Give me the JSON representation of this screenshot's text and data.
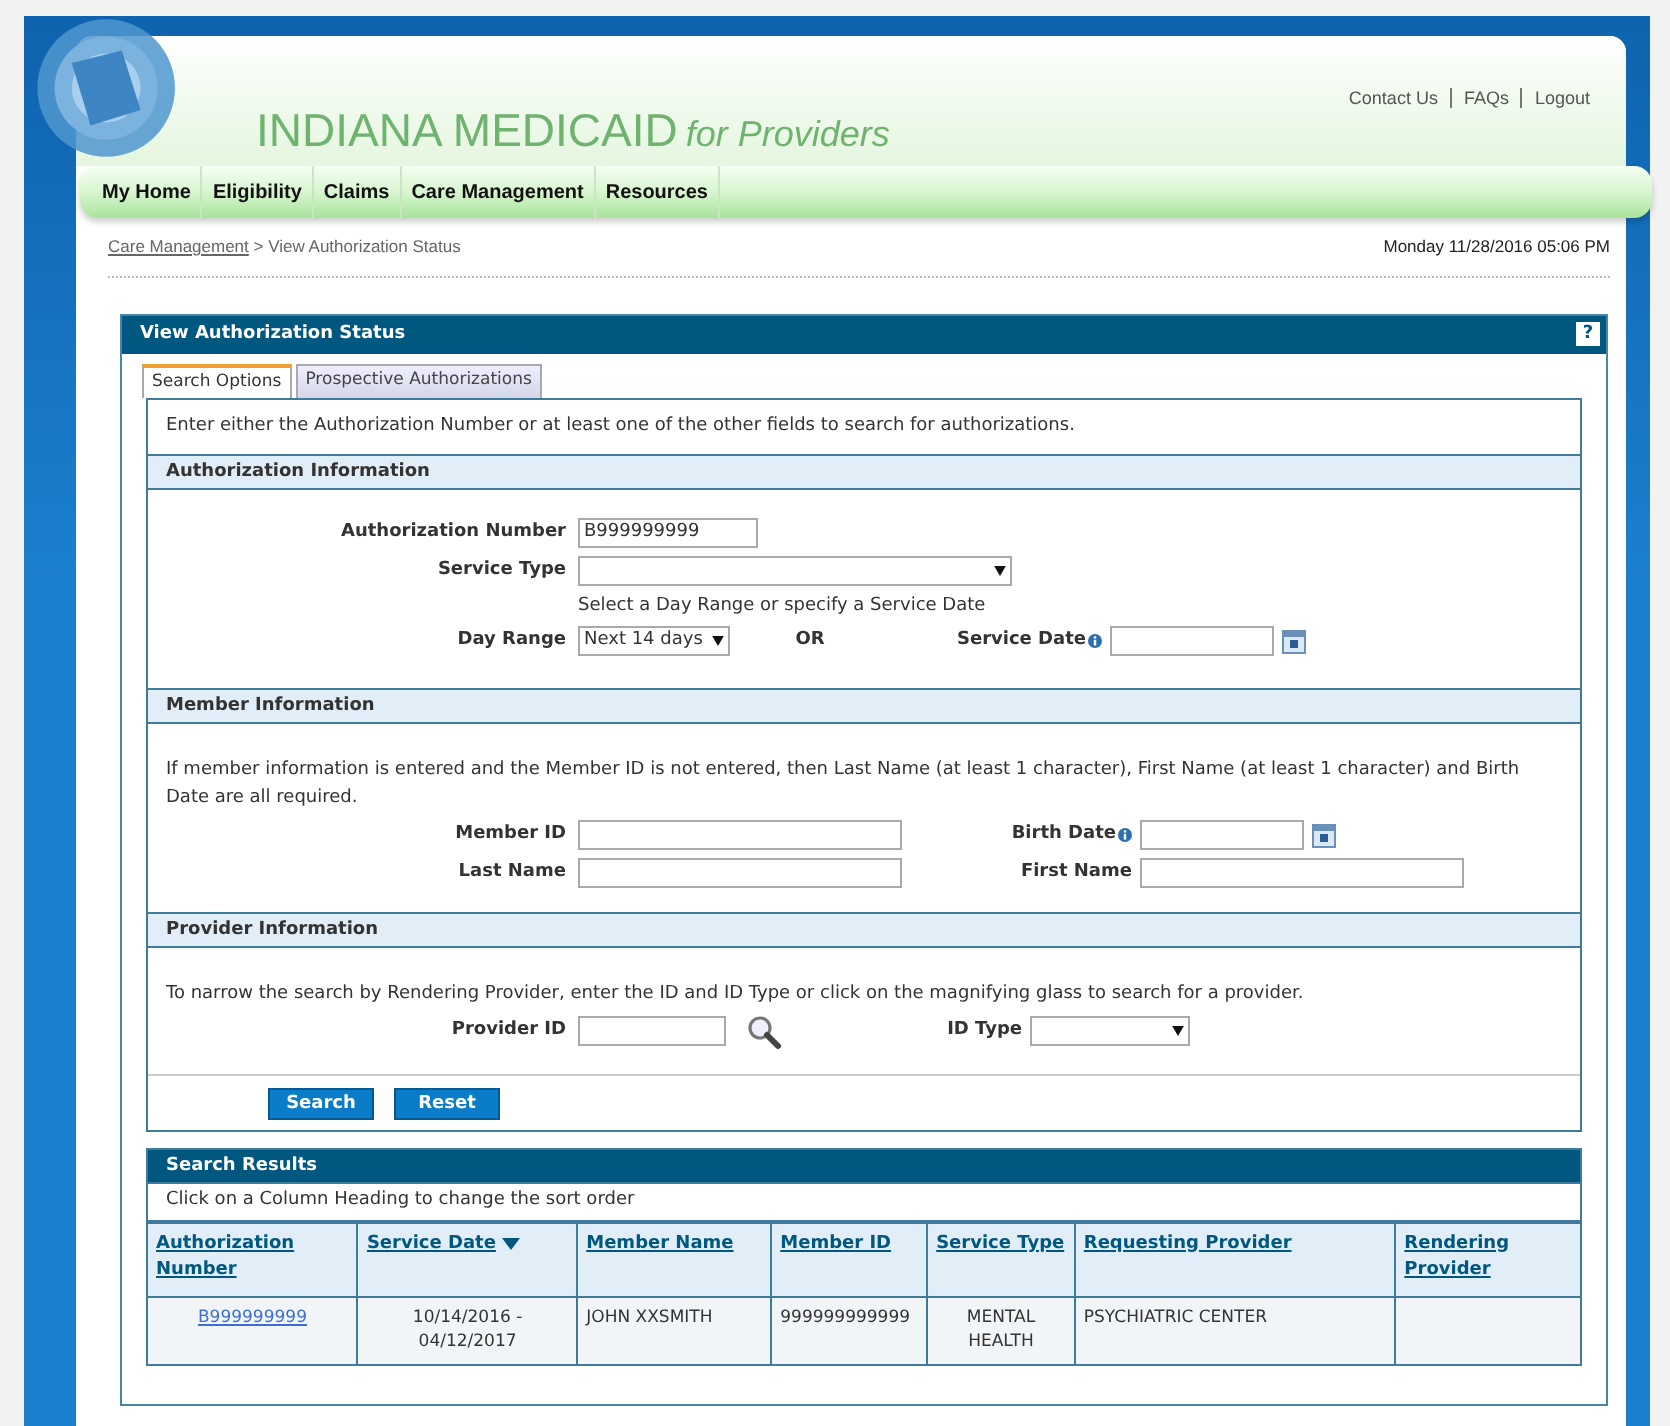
{
  "header": {
    "title": "INDIANA MEDICAID",
    "subtitle": "for Providers",
    "links": [
      {
        "label": "Contact Us"
      },
      {
        "label": "FAQs"
      },
      {
        "label": "Logout"
      }
    ]
  },
  "nav": [
    {
      "label": "My Home"
    },
    {
      "label": "Eligibility"
    },
    {
      "label": "Claims"
    },
    {
      "label": "Care Management"
    },
    {
      "label": "Resources"
    }
  ],
  "breadcrumb": {
    "link": "Care Management",
    "current": "> View Authorization Status",
    "datetime": "Monday 11/28/2016 05:06 PM"
  },
  "panel": {
    "title": "View Authorization Status",
    "help": "?"
  },
  "tabs": [
    {
      "label": "Search Options",
      "selected": true
    },
    {
      "label": "Prospective Authorizations",
      "selected": false
    }
  ],
  "intro": "Enter either the Authorization Number or at least one of the other fields to search for authorizations.",
  "sections": [
    {
      "title": "Authorization Information",
      "rows": [
        {
          "kind": "fields",
          "items": [
            {
              "label": "Authorization Number",
              "kind": "text",
              "value": "B999999999"
            }
          ]
        },
        {
          "kind": "fields",
          "items": [
            {
              "label": "Service Type",
              "kind": "select"
            }
          ]
        },
        {
          "kind": "note",
          "text": "Select a Day Range or specify a Service Date"
        },
        {
          "kind": "fields",
          "items": [
            {
              "label": "Day Range",
              "kind": "select",
              "value": "Next 14 days"
            },
            {
              "label": "Service Date",
              "kind": "date",
              "info": true
            }
          ],
          "joiner": "OR"
        }
      ]
    },
    {
      "title": "Member Information",
      "rows": [
        {
          "kind": "para",
          "text": "If member information is entered and the Member ID is not entered, then Last Name (at least 1 character), First Name (at least 1 character) and Birth Date are all required."
        },
        {
          "kind": "fields",
          "items": [
            {
              "label": "Member ID",
              "kind": "text"
            },
            {
              "label": "Birth Date",
              "kind": "date",
              "info": true
            }
          ]
        },
        {
          "kind": "fields",
          "items": [
            {
              "label": "Last Name",
              "kind": "text"
            },
            {
              "label": "First Name",
              "kind": "text"
            }
          ]
        }
      ]
    },
    {
      "title": "Provider Information",
      "rows": [
        {
          "kind": "para",
          "text": "To narrow the search by Rendering Provider, enter the ID and ID Type or click on the magnifying glass to search for a provider."
        },
        {
          "kind": "fields",
          "items": [
            {
              "label": "Provider ID",
              "kind": "lookup"
            },
            {
              "label": "ID Type",
              "kind": "select"
            }
          ]
        }
      ]
    }
  ],
  "buttons": [
    {
      "label": "Search"
    },
    {
      "label": "Reset"
    }
  ],
  "results": {
    "title": "Search Results",
    "hint": "Click on a Column Heading to change the sort order",
    "columns": [
      {
        "label": "Authorization Number",
        "sorted": false
      },
      {
        "label": "Service Date",
        "sorted": true
      },
      {
        "label": "Member Name",
        "sorted": false
      },
      {
        "label": "Member ID",
        "sorted": false
      },
      {
        "label": "Service Type",
        "sorted": false
      },
      {
        "label": "Requesting Provider",
        "sorted": false
      },
      {
        "label": "Rendering Provider",
        "sorted": false
      }
    ],
    "rows": [
      {
        "cells": [
          {
            "text": "B999999999",
            "kind": "link"
          },
          {
            "text": "10/14/2016 - 04/12/2017",
            "kind": "center"
          },
          {
            "text": "JOHN XXSMITH",
            "kind": "plain"
          },
          {
            "text": "999999999999",
            "kind": "plain"
          },
          {
            "text": "MENTAL HEALTH",
            "kind": "center"
          },
          {
            "text": "PSYCHIATRIC CENTER",
            "kind": "plain"
          },
          {
            "text": "",
            "kind": "plain"
          }
        ]
      }
    ]
  }
}
